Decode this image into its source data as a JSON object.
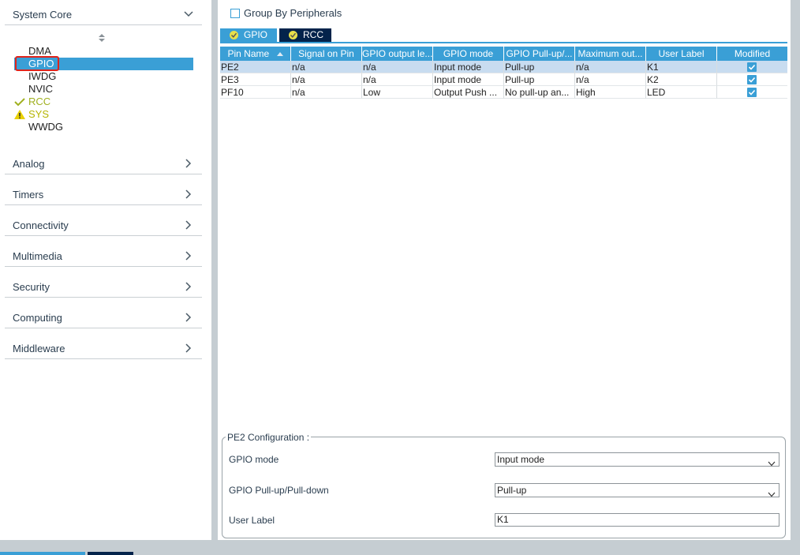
{
  "sidebar": {
    "categories": [
      {
        "label": "System Core",
        "icon": "chevron-down-icon"
      },
      {
        "label": "Analog",
        "icon": "chevron-right-icon"
      },
      {
        "label": "Timers",
        "icon": "chevron-right-icon"
      },
      {
        "label": "Connectivity",
        "icon": "chevron-right-icon"
      },
      {
        "label": "Multimedia",
        "icon": "chevron-right-icon"
      },
      {
        "label": "Security",
        "icon": "chevron-right-icon"
      },
      {
        "label": "Computing",
        "icon": "chevron-right-icon"
      },
      {
        "label": "Middleware",
        "icon": "chevron-right-icon"
      }
    ],
    "peripherals": [
      {
        "label": "DMA",
        "status": "none"
      },
      {
        "label": "GPIO",
        "status": "selected"
      },
      {
        "label": "IWDG",
        "status": "none"
      },
      {
        "label": "NVIC",
        "status": "none"
      },
      {
        "label": "RCC",
        "status": "ok"
      },
      {
        "label": "SYS",
        "status": "warning"
      },
      {
        "label": "WWDG",
        "status": "none"
      }
    ]
  },
  "main": {
    "group_by_label": "Group By Peripherals",
    "group_by_checked": false,
    "tabs": [
      {
        "label": "GPIO",
        "active": true
      },
      {
        "label": "RCC",
        "active": false
      }
    ],
    "table": {
      "columns": [
        "Pin Name",
        "Signal on Pin",
        "GPIO output le...",
        "GPIO mode",
        "GPIO Pull-up/...",
        "Maximum out...",
        "User Label",
        "Modified"
      ],
      "rows": [
        {
          "cells": [
            "PE2",
            "n/a",
            "n/a",
            "Input mode",
            "Pull-up",
            "n/a",
            "K1"
          ],
          "modified": true,
          "selected": true
        },
        {
          "cells": [
            "PE3",
            "n/a",
            "n/a",
            "Input mode",
            "Pull-up",
            "n/a",
            "K2"
          ],
          "modified": true,
          "selected": false
        },
        {
          "cells": [
            "PF10",
            "n/a",
            "Low",
            "Output Push ...",
            "No pull-up an...",
            "High",
            "LED"
          ],
          "modified": true,
          "selected": false
        }
      ]
    },
    "config": {
      "legend": "PE2 Configuration :",
      "fields": [
        {
          "label": "GPIO mode",
          "value": "Input mode",
          "type": "select"
        },
        {
          "label": "GPIO Pull-up/Pull-down",
          "value": "Pull-up",
          "type": "select"
        },
        {
          "label": "User Label",
          "value": "K1",
          "type": "text"
        }
      ]
    }
  },
  "colors": {
    "accent": "#3a9fd6",
    "dark_tab": "#03234b",
    "ok": "#a0b020",
    "warning": "#b4b400",
    "selection_outline": "#e0241b"
  }
}
